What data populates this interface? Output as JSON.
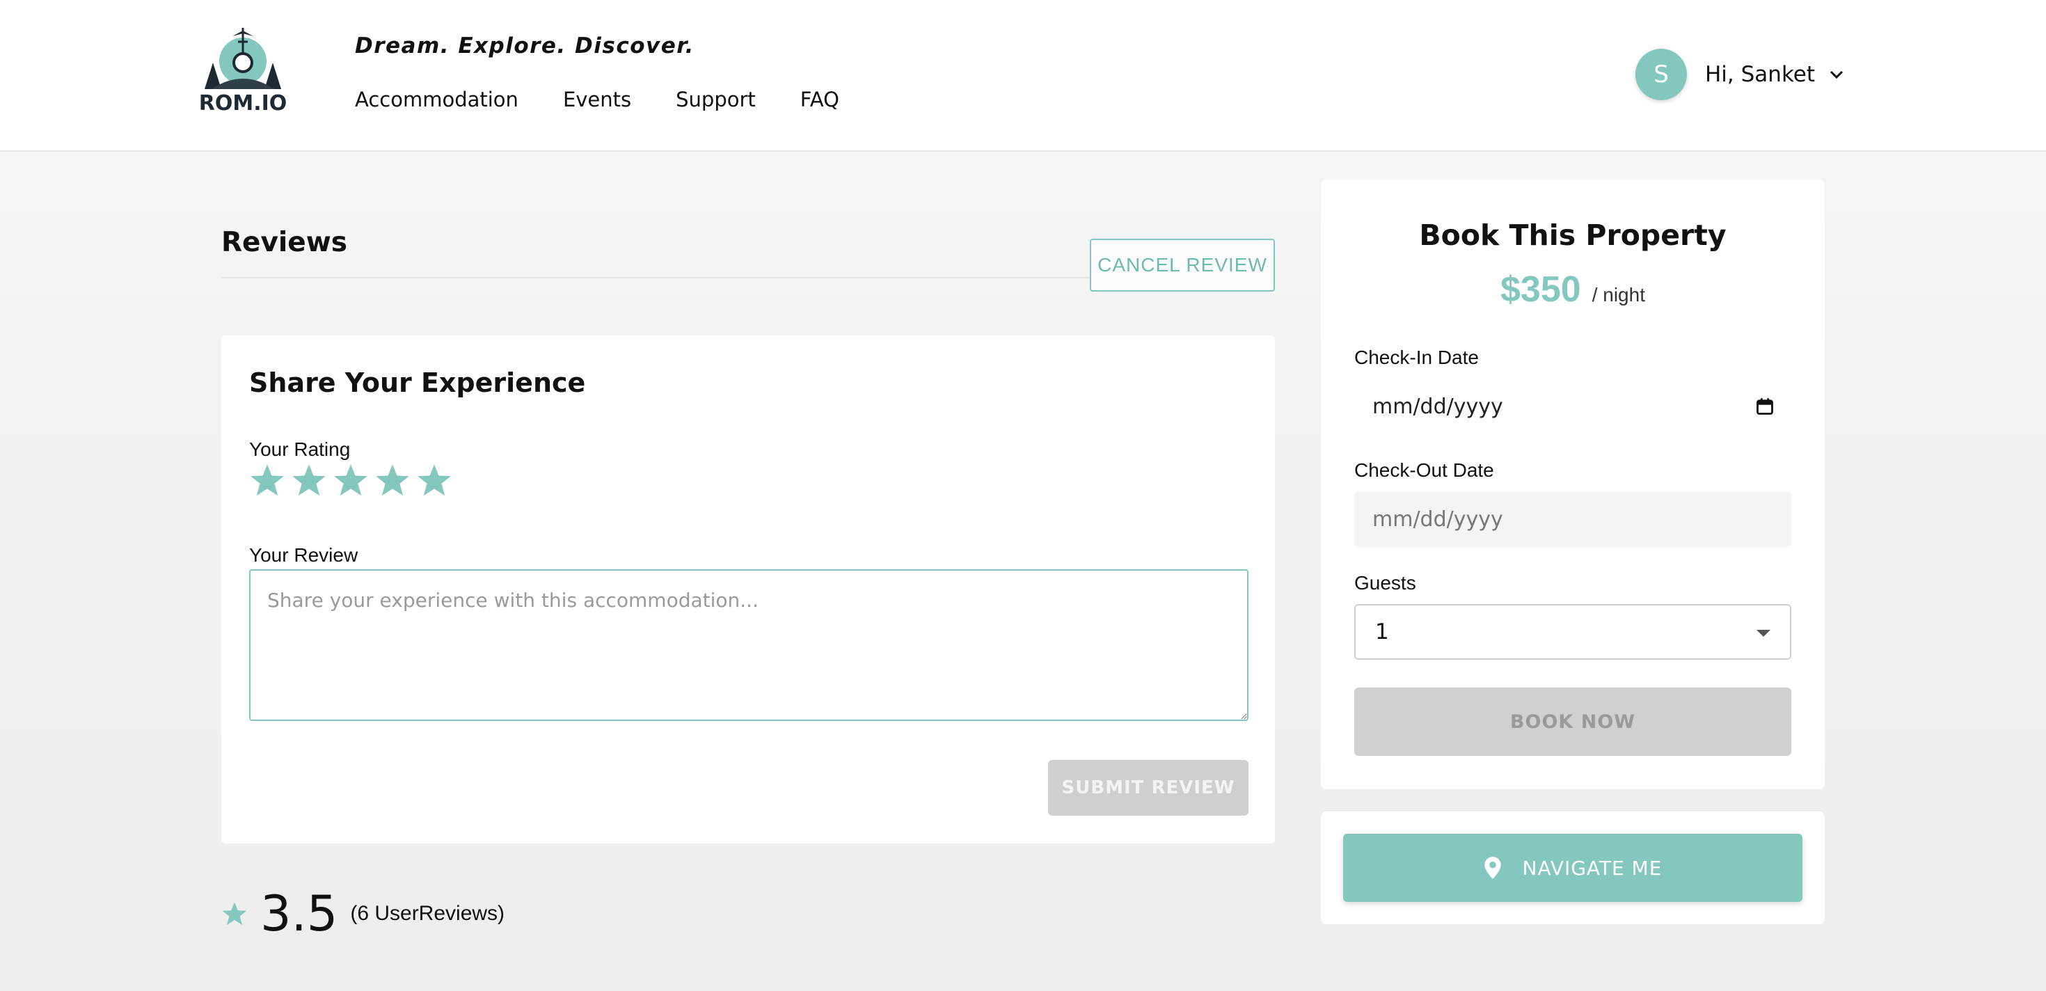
{
  "header": {
    "brand": "ROM.IO",
    "tagline": "Dream. Explore. Discover.",
    "nav": [
      {
        "label": "Accommodation"
      },
      {
        "label": "Events"
      },
      {
        "label": "Support"
      },
      {
        "label": "FAQ"
      }
    ],
    "user": {
      "initial": "S",
      "greeting": "Hi, Sanket"
    }
  },
  "reviews": {
    "title": "Reviews",
    "cancel_label": "CANCEL REVIEW",
    "form": {
      "title": "Share Your Experience",
      "rating_label": "Your Rating",
      "star_count": 5,
      "review_label": "Your Review",
      "review_placeholder": "Share your experience with this accommodation...",
      "submit_label": "SUBMIT REVIEW"
    },
    "summary": {
      "score": "3.5",
      "count_text": "(6 UserReviews)"
    }
  },
  "booking": {
    "title": "Book This Property",
    "price": "$350",
    "per_night": "/ night",
    "checkin_label": "Check-In Date",
    "checkin_value": "mm/dd/yyyy",
    "checkout_label": "Check-Out Date",
    "checkout_value": "mm/dd/yyyy",
    "guests_label": "Guests",
    "guests_value": "1",
    "book_label": "BOOK NOW"
  },
  "navigate": {
    "label": "NAVIGATE ME"
  },
  "colors": {
    "accent": "#84c7bf",
    "disabled": "#cfcfcf",
    "text": "#111111"
  }
}
